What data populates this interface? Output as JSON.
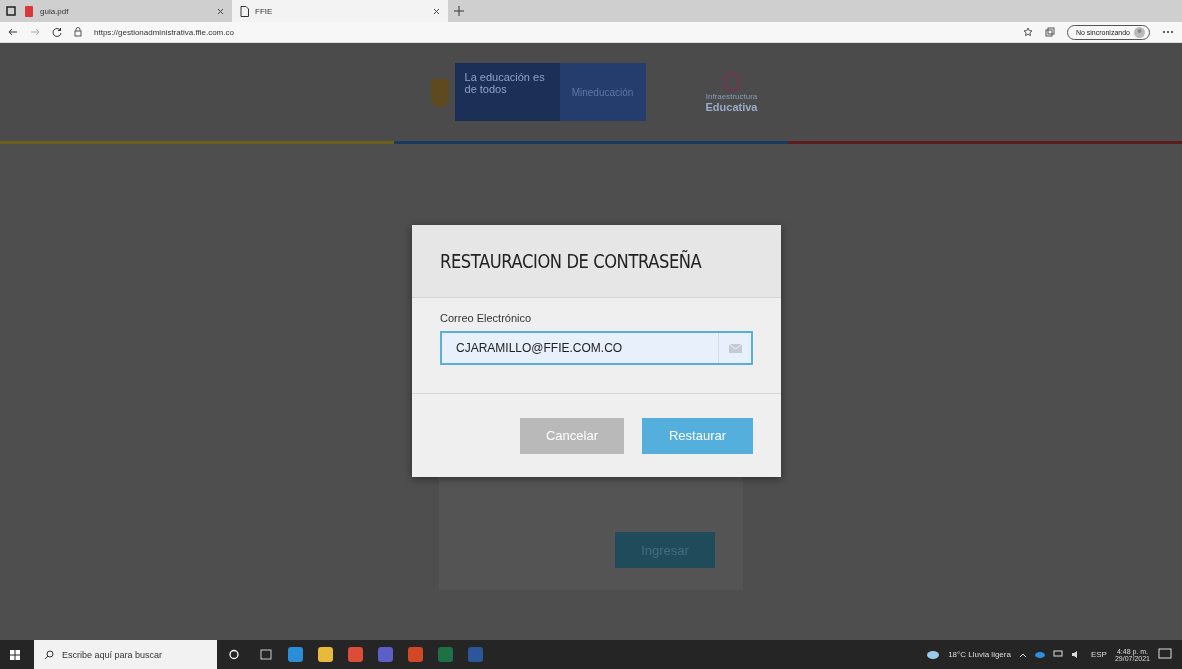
{
  "browser": {
    "tabs": [
      {
        "title": "guia.pdf",
        "kind": "pdf",
        "selected": false
      },
      {
        "title": "FFIE",
        "kind": "page",
        "selected": true
      }
    ],
    "url": "https://gestionadministrativa.ffie.com.co",
    "profile_label": "No sincronizando"
  },
  "header": {
    "slogan": "La educación es de todos",
    "ministry": "Mineducación",
    "brand_small": "Infraestructura",
    "brand_large": "Educativa"
  },
  "login": {
    "submit": "Ingresar"
  },
  "modal": {
    "title": "RESTAURACION DE CONTRASEÑA",
    "field_label": "Correo Electrónico",
    "email": "CJARAMILLO@FFIE.COM.CO",
    "cancel": "Cancelar",
    "confirm": "Restaurar"
  },
  "taskbar": {
    "search_placeholder": "Escribe aquí para buscar",
    "weather": "18°C  Lluvia ligera",
    "language": "ESP",
    "time": "4:48 p. m.",
    "date": "29/07/2021"
  }
}
